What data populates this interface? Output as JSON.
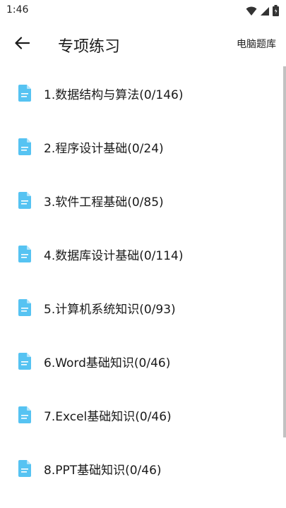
{
  "status_bar": {
    "time": "1:46",
    "icons": [
      "wifi-icon",
      "signal-icon",
      "battery-icon"
    ]
  },
  "app_bar": {
    "title": "专项练习",
    "action_label": "电脑题库",
    "back_icon": "arrow-back-icon"
  },
  "list": {
    "items": [
      {
        "label": "1.数据结构与算法(0/146)",
        "icon": "document-icon"
      },
      {
        "label": "2.程序设计基础(0/24)",
        "icon": "document-icon"
      },
      {
        "label": "3.软件工程基础(0/85)",
        "icon": "document-icon"
      },
      {
        "label": "4.数据库设计基础(0/114)",
        "icon": "document-icon"
      },
      {
        "label": "5.计算机系统知识(0/93)",
        "icon": "document-icon"
      },
      {
        "label": "6.Word基础知识(0/46)",
        "icon": "document-icon"
      },
      {
        "label": "7.Excel基础知识(0/46)",
        "icon": "document-icon"
      },
      {
        "label": "8.PPT基础知识(0/46)",
        "icon": "document-icon"
      }
    ]
  },
  "colors": {
    "accent_icon": "#56c3f2",
    "text": "#1a1a1a",
    "scrollbar": "#c2c2c2"
  }
}
